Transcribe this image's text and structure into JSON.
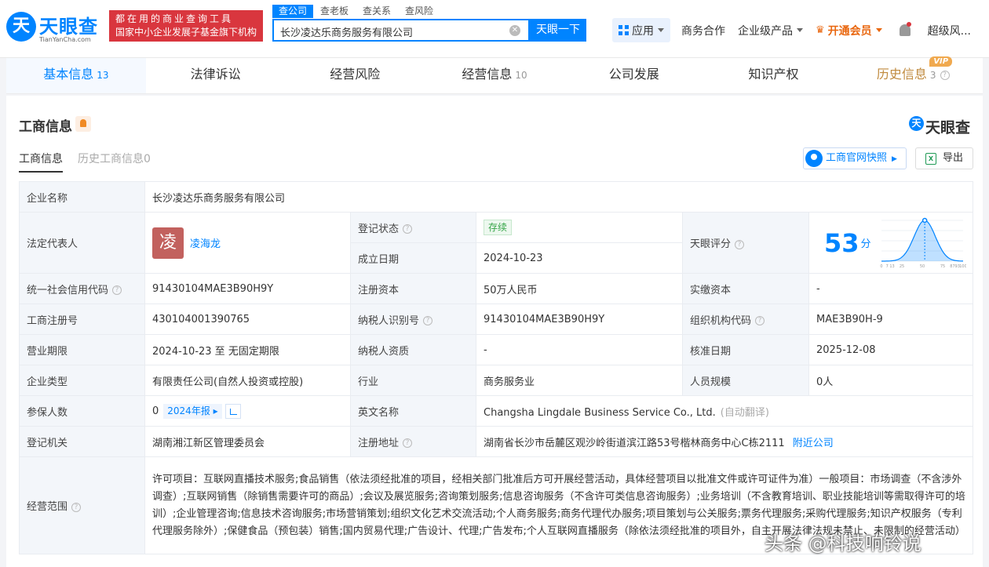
{
  "brand": {
    "logo_mark": "天",
    "name": "天眼查",
    "domain": "TianYanCha.com",
    "slogan_line1": "都在用的商业查询工具",
    "slogan_line2": "国家中小企业发展子基金旗下机构"
  },
  "search": {
    "tabs": [
      "查公司",
      "查老板",
      "查关系",
      "查风险"
    ],
    "value": "长沙凌达乐商务服务有限公司",
    "button": "天眼一下"
  },
  "topnav": {
    "app": "应用",
    "cooperation": "商务合作",
    "enterprise": "企业级产品",
    "vip": "开通会员",
    "user": "超级风..."
  },
  "tabs": [
    {
      "label": "基本信息",
      "count": "13"
    },
    {
      "label": "法律诉讼",
      "count": ""
    },
    {
      "label": "经营风险",
      "count": ""
    },
    {
      "label": "经营信息",
      "count": "10"
    },
    {
      "label": "公司发展",
      "count": ""
    },
    {
      "label": "知识产权",
      "count": ""
    },
    {
      "label": "历史信息",
      "count": "3",
      "badge": "VIP"
    }
  ],
  "section": {
    "title": "工商信息",
    "logo": "天眼查",
    "sub_tabs": [
      "工商信息",
      "历史工商信息0"
    ],
    "official_button": "工商官网快照",
    "export_button": "导出"
  },
  "labels": {
    "company_name": "企业名称",
    "legal_rep": "法定代表人",
    "reg_status": "登记状态",
    "established": "成立日期",
    "score": "天眼评分",
    "credit_code": "统一社会信用代码",
    "reg_capital": "注册资本",
    "paid_capital": "实缴资本",
    "reg_number": "工商注册号",
    "taxpayer_id": "纳税人识别号",
    "org_code": "组织机构代码",
    "term": "营业期限",
    "taxpayer_qual": "纳税人资质",
    "approval_date": "核准日期",
    "type": "企业类型",
    "industry": "行业",
    "staff_size": "人员规模",
    "insured": "参保人数",
    "english_name": "英文名称",
    "authority": "登记机关",
    "address": "注册地址",
    "scope": "经营范围"
  },
  "values": {
    "company_name": "长沙凌达乐商务服务有限公司",
    "legal_rep_avatar": "凌",
    "legal_rep": "凌海龙",
    "reg_status": "存续",
    "established": "2024-10-23",
    "score": "53",
    "score_unit": "分",
    "credit_code": "91430104MAE3B90H9Y",
    "reg_capital": "50万人民币",
    "paid_capital": "-",
    "reg_number": "430104001390765",
    "taxpayer_id": "91430104MAE3B90H9Y",
    "org_code": "MAE3B90H-9",
    "term": "2024-10-23 至 无固定期限",
    "taxpayer_qual": "-",
    "approval_date": "2025-12-08",
    "type": "有限责任公司(自然人投资或控股)",
    "industry": "商务服务业",
    "staff_size": "0人",
    "insured": "0",
    "insured_year": "2024年报",
    "english_name": "Changsha Lingdale Business Service Co., Ltd.",
    "english_note": "(自动翻译)",
    "authority": "湖南湘江新区管理委员会",
    "address": "湖南省长沙市岳麓区观沙岭街道滨江路53号楷林商务中心C栋2111",
    "address_link": "附近公司",
    "scope": "许可项目：互联网直播技术服务;食品销售（依法须经批准的项目，经相关部门批准后方可开展经营活动，具体经营项目以批准文件或许可证件为准）一般项目：市场调查（不含涉外调查）;互联网销售（除销售需要许可的商品）;会议及展览服务;咨询策划服务;信息咨询服务（不含许可类信息咨询服务）;业务培训（不含教育培训、职业技能培训等需取得许可的培训）;企业管理咨询;信息技术咨询服务;市场营销策划;组织文化艺术交流活动;个人商务服务;商务代理代办服务;项目策划与公关服务;票务代理服务;采购代理服务;知识产权服务（专利代理服务除外）;保健食品（预包装）销售;国内贸易代理;广告设计、代理;广告发布;个人互联网直播服务（除依法须经批准的项目外，自主开展法律法规未禁止、未限制的经营活动）"
  },
  "score_chart": {
    "ticks": [
      "0",
      "7",
      "13",
      "25",
      "50",
      "75",
      "87",
      "93",
      "100"
    ],
    "marker": 53,
    "color": "#0084ff"
  },
  "watermark": "头条 @科技响铃说"
}
